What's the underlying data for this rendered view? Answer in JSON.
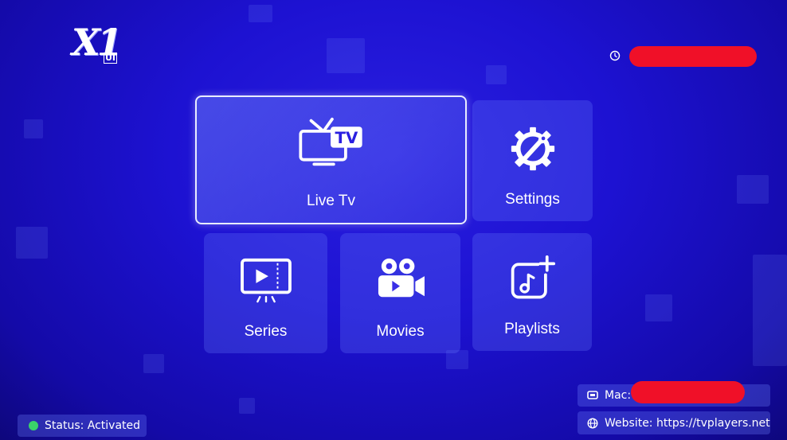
{
  "app": {
    "logo_text": "X1",
    "logo_sub": "UI"
  },
  "header": {
    "clock_icon": "clock-icon"
  },
  "menu": {
    "live_tv": {
      "label": "Live Tv",
      "icon": "tv-icon",
      "icon_text": "TV"
    },
    "settings": {
      "label": "Settings",
      "icon": "gear-wrench-icon"
    },
    "series": {
      "label": "Series",
      "icon": "series-play-icon"
    },
    "movies": {
      "label": "Movies",
      "icon": "movie-camera-icon"
    },
    "playlists": {
      "label": "Playlists",
      "icon": "playlist-add-icon"
    }
  },
  "footer": {
    "status_text": "Status: Activated",
    "mac_label": "Mac:",
    "website_text": "Website: https://tvplayers.net"
  },
  "colors": {
    "background": "#1d12d2",
    "status_ok": "#3ad36a",
    "redaction": "#f01028"
  }
}
